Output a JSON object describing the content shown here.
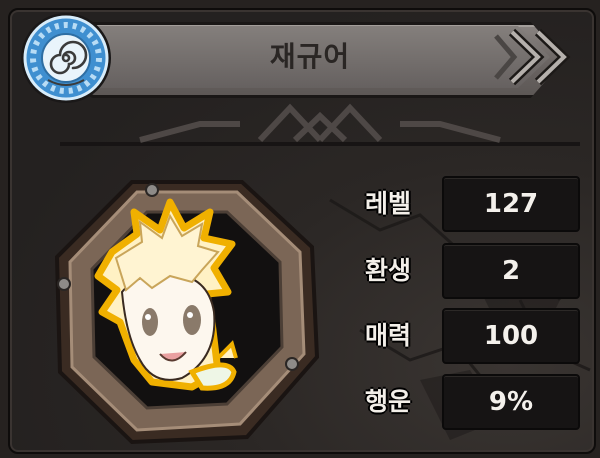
{
  "character": {
    "name": "재규어"
  },
  "stats": [
    {
      "label": "레벨",
      "value": "127"
    },
    {
      "label": "환생",
      "value": "2"
    },
    {
      "label": "매력",
      "value": "100"
    },
    {
      "label": "행운",
      "value": "9%"
    }
  ],
  "colors": {
    "panel_bg": "#262220",
    "name_bar": "#6f6a67",
    "emblem_blue": "#4aa8e6",
    "frame_bronze": "#7a6552",
    "portrait_outline": "#f0b000",
    "stat_box": "#161414"
  },
  "icons": {
    "emblem": "spiral-emblem-icon",
    "chevron": "double-chevron-right-icon",
    "avatar": "spiky-blonde-hero-portrait"
  }
}
